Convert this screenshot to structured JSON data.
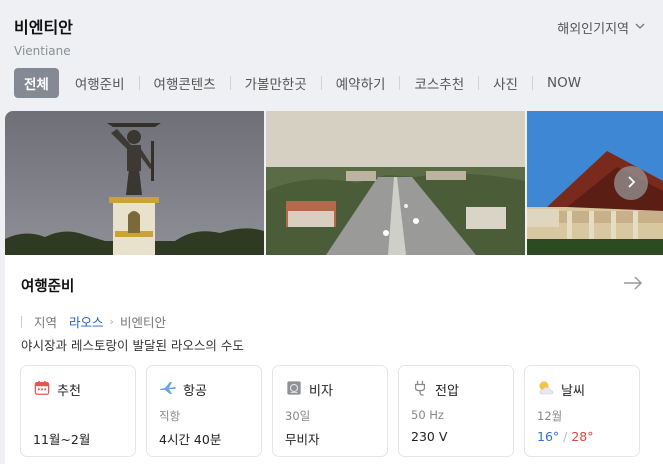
{
  "header": {
    "title": "비엔티안",
    "subtitle": "Vientiane",
    "region_link": "해외인기지역"
  },
  "tabs": [
    {
      "label": "전체",
      "active": true
    },
    {
      "label": "여행준비"
    },
    {
      "label": "여행콘텐츠"
    },
    {
      "label": "가볼만한곳"
    },
    {
      "label": "예약하기"
    },
    {
      "label": "코스추천"
    },
    {
      "label": "사진"
    },
    {
      "label": "NOW"
    }
  ],
  "gallery": {
    "photos": [
      "statue",
      "city-view",
      "temple"
    ]
  },
  "prep_card": {
    "title": "여행준비",
    "breadcrumb": {
      "label": "지역",
      "country": "라오스",
      "city": "비엔티안"
    },
    "description": "야시장과 레스토랑이 발달된 라오스의 수도",
    "items": [
      {
        "icon": "calendar-icon",
        "name": "추천",
        "note": "",
        "value": "11월~2월"
      },
      {
        "icon": "airplane-icon",
        "name": "항공",
        "note": "직항",
        "value": "4시간 40분"
      },
      {
        "icon": "passport-icon",
        "name": "비자",
        "note": "30일",
        "value": "무비자"
      },
      {
        "icon": "plug-icon",
        "name": "전압",
        "note": "50 Hz",
        "value": "230 V"
      },
      {
        "icon": "weather-icon",
        "name": "날씨",
        "note": "12월",
        "low": "16°",
        "slash": " / ",
        "high": "28°"
      }
    ]
  },
  "colors": {
    "accent_link": "#2460c8",
    "temp_low": "#2f6fe0",
    "temp_high": "#e0463d",
    "tab_active_bg": "#848a93"
  }
}
